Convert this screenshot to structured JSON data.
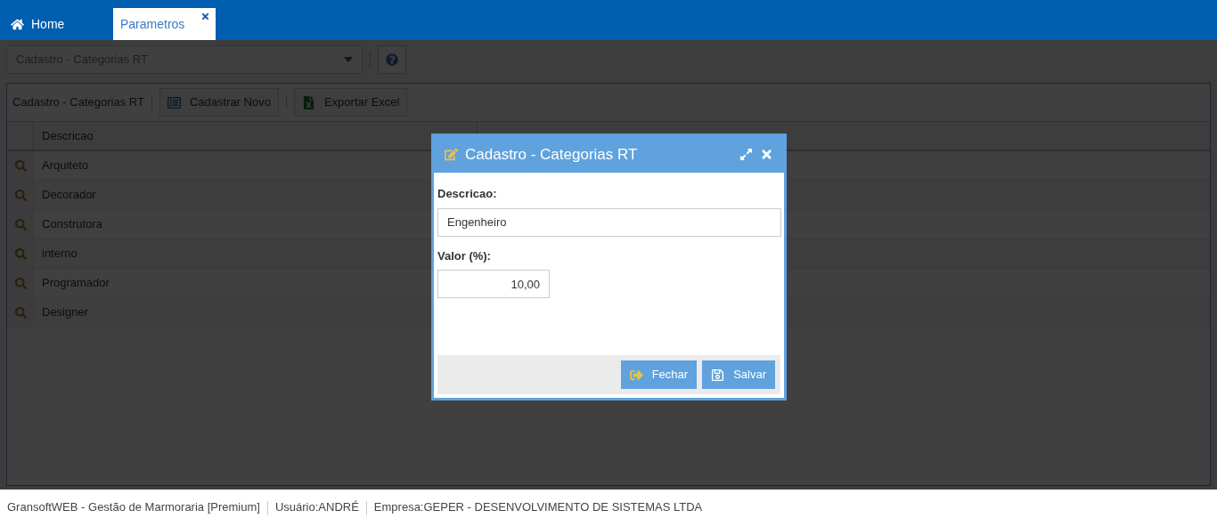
{
  "tabs": [
    {
      "label": "Home",
      "selected": false,
      "closable": false
    },
    {
      "label": "Parametros",
      "selected": true,
      "closable": true
    }
  ],
  "screen_select": {
    "value": "Cadastro - Categorias RT"
  },
  "panel": {
    "title": "Cadastro - Categorias RT",
    "buttons": [
      {
        "kind": "new",
        "label": "Cadastrar Novo"
      },
      {
        "kind": "excel",
        "label": "Exportar Excel"
      }
    ],
    "columns": [
      "Descricao"
    ],
    "rows": [
      "Arquiteto",
      "Decorador",
      "Construtora",
      "interno",
      "Programador",
      "Designer"
    ]
  },
  "dialog": {
    "title": "Cadastro - Categorias RT",
    "fields": [
      {
        "kind": "text",
        "label": "Descricao:",
        "value": "Engenheiro"
      },
      {
        "kind": "number",
        "label": "Valor (%):",
        "value": "10,00"
      }
    ],
    "buttons": [
      {
        "kind": "close",
        "label": "Fechar"
      },
      {
        "kind": "save",
        "label": "Salvar"
      }
    ]
  },
  "status_bar": [
    "GransoftWEB - Gestão de Marmoraria [Premium]",
    "Usuário:ANDRÉ",
    "Empresa:GEPER - DESENVOLVIMENTO DE SISTEMAS LTDA"
  ]
}
